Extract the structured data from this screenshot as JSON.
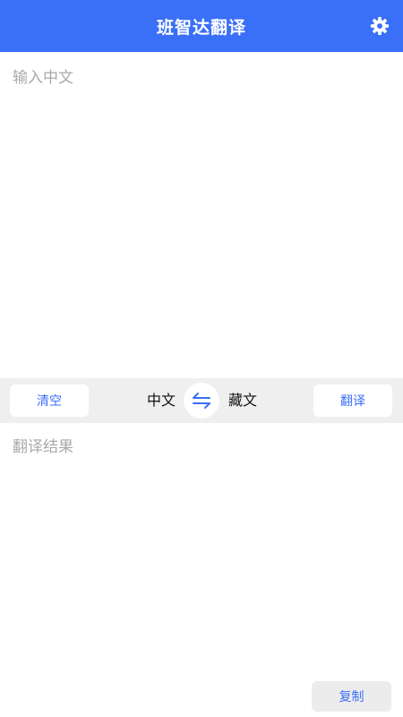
{
  "header": {
    "title": "班智达翻译",
    "settings_icon": "gear-icon"
  },
  "input": {
    "value": "",
    "placeholder": "输入中文"
  },
  "toolbar": {
    "clear_label": "清空",
    "source_lang": "中文",
    "swap_icon": "swap-arrows-icon",
    "target_lang": "藏文",
    "translate_label": "翻译"
  },
  "result": {
    "placeholder": "翻译结果"
  },
  "footer": {
    "copy_label": "复制"
  },
  "colors": {
    "primary": "#3a6ff7",
    "toolbar_bg": "#efefef",
    "placeholder": "#a9a9a9"
  }
}
